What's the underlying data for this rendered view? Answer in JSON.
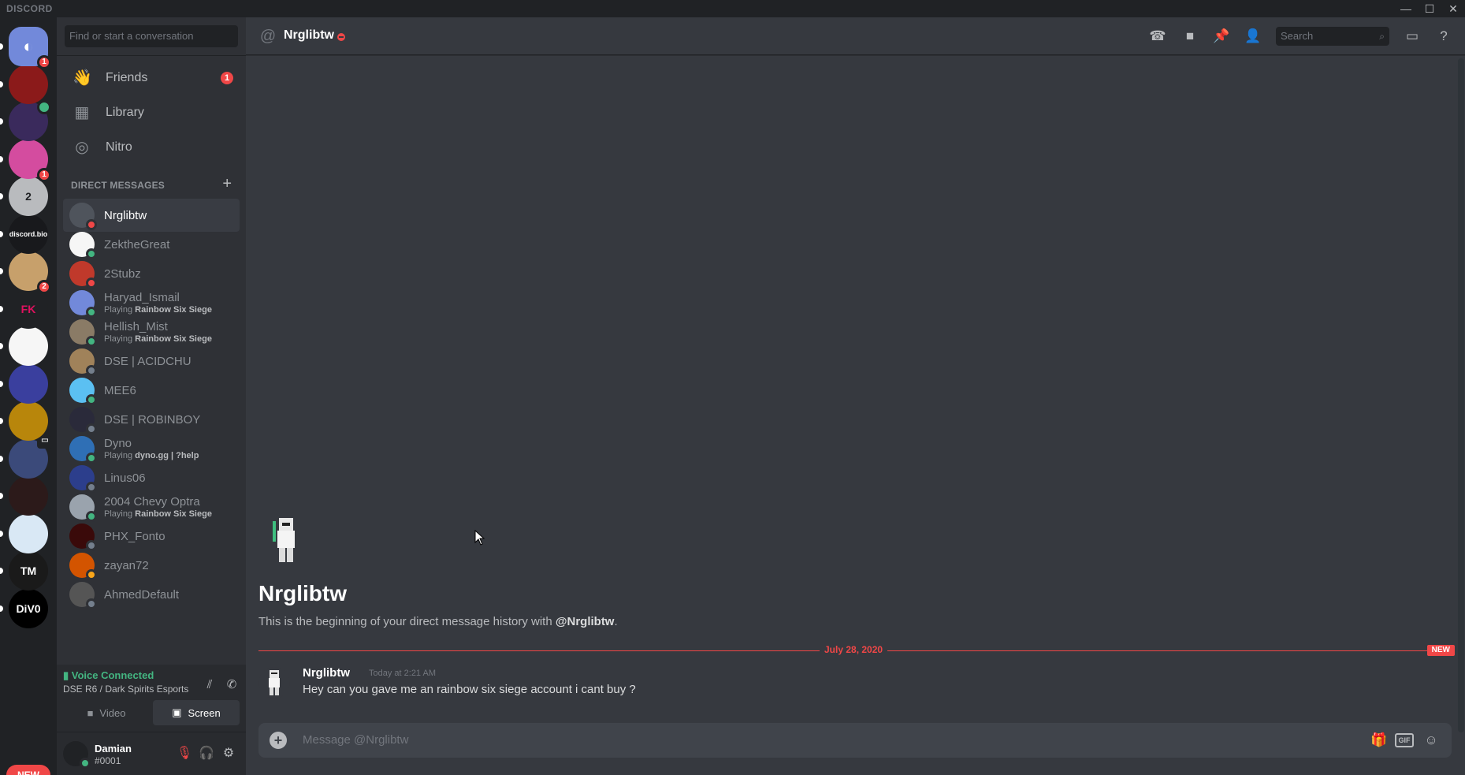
{
  "window": {
    "brand": "DISCORD",
    "controls": [
      "—",
      "☐",
      "✕"
    ]
  },
  "rail": {
    "servers": [
      {
        "name": "home",
        "label": "",
        "color": "#7289da",
        "badge": "1",
        "pip": true
      },
      {
        "name": "ignite-esports",
        "label": "",
        "color": "#8b1a1a",
        "badge": "",
        "pip": true
      },
      {
        "name": "purple-warrior",
        "label": "",
        "color": "#3a2a5c",
        "badge": "",
        "speaker": true,
        "pip": true
      },
      {
        "name": "pink-guy",
        "label": "",
        "color": "#d44c9f",
        "badge": "1",
        "pip": true
      },
      {
        "name": "y2",
        "label": "2",
        "color": "#b9bbbe",
        "badge": "",
        "pip": true
      },
      {
        "name": "discord-bio",
        "label": "discord.bio",
        "color": "#18191c",
        "badge": "",
        "pip": true
      },
      {
        "name": "cartoon",
        "label": "",
        "color": "#c7a06b",
        "badge": "2",
        "pip": true
      },
      {
        "name": "fk-logo",
        "label": "FK",
        "color": "#202225",
        "badge": "",
        "pip": true
      },
      {
        "name": "wings",
        "label": "",
        "color": "#f6f6f6",
        "badge": "",
        "pip": true
      },
      {
        "name": "star",
        "label": "",
        "color": "#3a3f9e",
        "badge": "",
        "pip": true
      },
      {
        "name": "rainbow-six",
        "label": "",
        "color": "#b8860b",
        "badge": "",
        "pip": true
      },
      {
        "name": "play",
        "label": "",
        "color": "#3b4a7a",
        "badge": "",
        "video": true,
        "pip": true
      },
      {
        "name": "red-ninja",
        "label": "",
        "color": "#2c1a1a",
        "badge": "",
        "pip": true
      },
      {
        "name": "mouse",
        "label": "",
        "color": "#d9e8f5",
        "badge": "",
        "pip": true
      },
      {
        "name": "tm",
        "label": "TM",
        "color": "#1a1a1a",
        "badge": "",
        "pip": true
      },
      {
        "name": "div0",
        "label": "DiV0",
        "color": "#000000",
        "badge": "",
        "pip": true
      }
    ],
    "new_label": "NEW"
  },
  "sidebar": {
    "search_placeholder": "Find or start a conversation",
    "nav": [
      {
        "label": "Friends",
        "icon": "friends-icon",
        "glyph": "👋",
        "count": "1"
      },
      {
        "label": "Library",
        "icon": "library-icon",
        "glyph": "▦",
        "count": ""
      },
      {
        "label": "Nitro",
        "icon": "nitro-icon",
        "glyph": "◎",
        "count": ""
      }
    ],
    "dm_header": "DIRECT MESSAGES",
    "dms": [
      {
        "name": "Nrglibtw",
        "activity": "",
        "game": "",
        "status": "#f04747",
        "color": "#4f545c",
        "active": true
      },
      {
        "name": "ZektheGreat",
        "activity": "",
        "game": "",
        "status": "#43b581",
        "color": "#f6f6f6"
      },
      {
        "name": "2Stubz",
        "activity": "",
        "game": "",
        "status": "#f04747",
        "color": "#c0392b"
      },
      {
        "name": "Haryad_Ismail",
        "activity": "Playing ",
        "game": "Rainbow Six Siege",
        "status": "#43b581",
        "color": "#7289da"
      },
      {
        "name": "Hellish_Mist",
        "activity": "Playing ",
        "game": "Rainbow Six Siege",
        "status": "#43b581",
        "color": "#8a7b66"
      },
      {
        "name": "DSE | ACIDCHU",
        "activity": "",
        "game": "",
        "status": "#747f8d",
        "color": "#a0825a"
      },
      {
        "name": "MEE6",
        "activity": "",
        "game": "",
        "status": "#43b581",
        "color": "#5bc0f2"
      },
      {
        "name": "DSE | ROBINBOY",
        "activity": "",
        "game": "",
        "status": "#747f8d",
        "color": "#2a2a3a"
      },
      {
        "name": "Dyno",
        "activity": "Playing ",
        "game": "dyno.gg | ?help",
        "status": "#43b581",
        "color": "#2f6fb5"
      },
      {
        "name": "Linus06",
        "activity": "",
        "game": "",
        "status": "#747f8d",
        "color": "#2c3e8c"
      },
      {
        "name": "2004 Chevy Optra",
        "activity": "Playing ",
        "game": "Rainbow Six Siege",
        "status": "#43b581",
        "color": "#9aa3ad"
      },
      {
        "name": "PHX_Fonto",
        "activity": "",
        "game": "",
        "status": "#747f8d",
        "color": "#3a0a0a"
      },
      {
        "name": "zayan72",
        "activity": "",
        "game": "",
        "status": "#faa61a",
        "color": "#d35400"
      },
      {
        "name": "AhmedDefault",
        "activity": "",
        "game": "",
        "status": "#747f8d",
        "color": "#555555"
      }
    ],
    "voice": {
      "status": "Voice Connected",
      "channel": "DSE R6 / Dark Spirits Esports",
      "video_label": "Video",
      "screen_label": "Screen"
    },
    "user": {
      "name": "Damian",
      "tag": "#0001"
    }
  },
  "main": {
    "channel_name": "Nrglibtw",
    "search_placeholder": "Search",
    "intro_title": "Nrglibtw",
    "intro_prefix": "This is the beginning of your direct message history with ",
    "intro_mention": "@Nrglibtw",
    "intro_suffix": ".",
    "divider_date": "July 28, 2020",
    "new_tag": "NEW",
    "message": {
      "author": "Nrglibtw",
      "time": "Today at 2:21 AM",
      "text": "Hey can you gave me an rainbow six siege account i cant buy ?"
    },
    "composer_placeholder": "Message @Nrglibtw",
    "gif_label": "GIF"
  }
}
